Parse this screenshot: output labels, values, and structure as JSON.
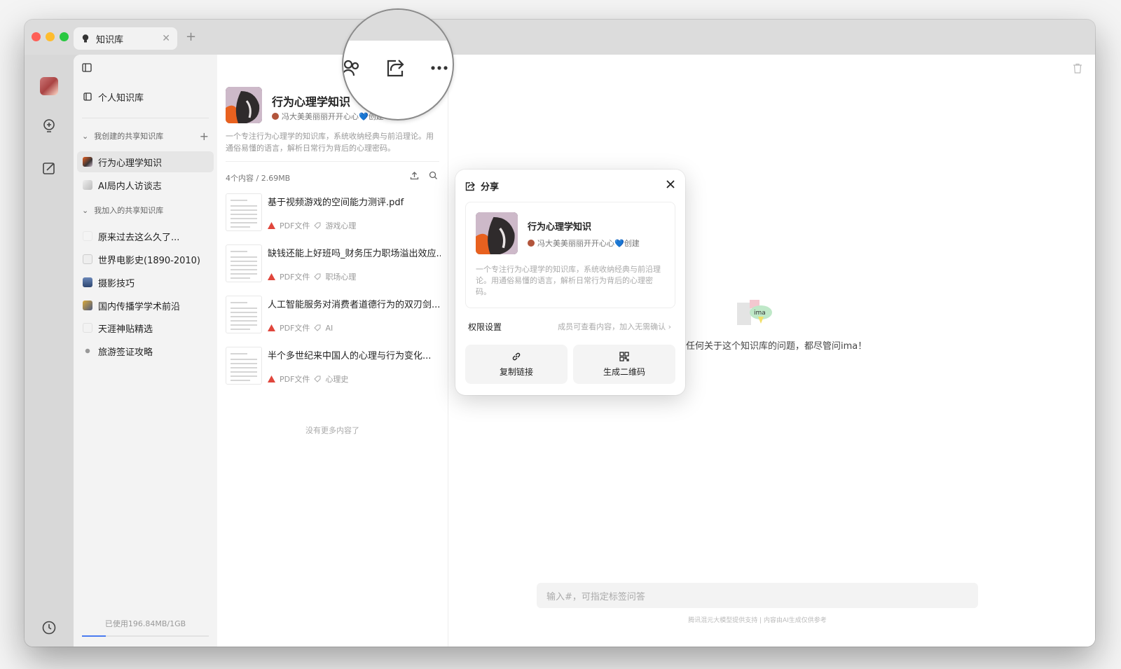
{
  "tab": {
    "title": "知识库"
  },
  "sidebar": {
    "personal": "个人知识库",
    "created_section": "我创建的共享知识库",
    "created_items": [
      "行为心理学知识",
      "AI局内人访谈志"
    ],
    "joined_section": "我加入的共享知识库",
    "joined_items": [
      "原来过去这么久了...",
      "世界电影史(1890-2010)",
      "摄影技巧",
      "国内传播学学术前沿",
      "天涯神贴精选",
      "旅游签证攻略"
    ],
    "storage": "已使用196.84MB/1GB",
    "storage_fraction": 0.19
  },
  "kb": {
    "title": "行为心理学知识",
    "creator": "冯大美美丽丽开开心心💙创建",
    "description": "一个专注行为心理学的知识库，系统收纳经典与前沿理论。用通俗易懂的语言，解析日常行为背后的心理密码。",
    "meta": "4个内容 / 2.69MB",
    "documents": [
      {
        "title": "基于视频游戏的空间能力测评.pdf",
        "type": "PDF文件",
        "tag": "游戏心理"
      },
      {
        "title": "缺钱还能上好班吗_财务压力职场溢出效应...",
        "type": "PDF文件",
        "tag": "职场心理"
      },
      {
        "title": "人工智能服务对消费者道德行为的双刃剑...",
        "type": "PDF文件",
        "tag": "AI"
      },
      {
        "title": "半个多世纪来中国人的心理与行为变化...",
        "type": "PDF文件",
        "tag": "心理史"
      }
    ],
    "end_note": "没有更多内容了"
  },
  "main": {
    "hint": "任何关于这个知识库的问题，都尽管问ima！",
    "input_placeholder": "输入#，可指定标签问答",
    "disclaimer": "腾讯混元大模型提供支持 | 内容由AI生成仅供参考",
    "logo_text": "ima"
  },
  "share": {
    "title": "分享",
    "kb_title": "行为心理学知识",
    "kb_creator": "冯大美美丽丽开开心心💙创建",
    "kb_description": "一个专注行为心理学的知识库，系统收纳经典与前沿理论。用通俗易懂的语言，解析日常行为背后的心理密码。",
    "permission_label": "权限设置",
    "permission_value": "成员可查看内容，加入无需确认",
    "copy_link": "复制链接",
    "qr_code": "生成二维码"
  },
  "colors": {
    "accent": "#4a7bf0",
    "pdf": "#e0463c",
    "sidebar_bg": "#f3f3f3"
  }
}
